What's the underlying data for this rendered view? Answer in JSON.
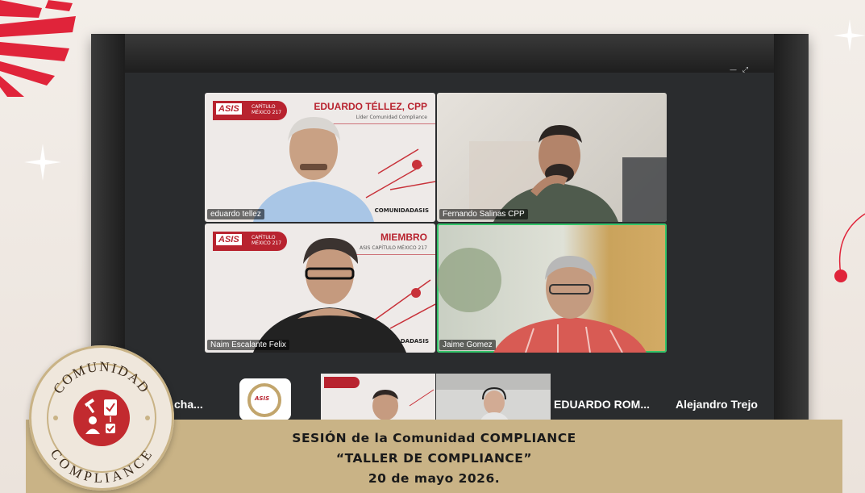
{
  "meeting": {
    "window_controls": "— ⤢",
    "tiles": [
      {
        "name": "eduardo tellez",
        "banner_title": "EDUARDO TÉLLEZ, CPP",
        "banner_sub": "Líder Comunidad Compliance",
        "footer": "COMUNIDADASIS"
      },
      {
        "name": "Fernando Salinas CPP"
      },
      {
        "name": "Naim Escalante Felix",
        "banner_title": "MIEMBRO",
        "banner_sub": "ASIS CAPÍTULO MÉXICO 217",
        "footer": "DADASIS"
      },
      {
        "name": "Jaime Gomez",
        "active_speaker": true
      }
    ],
    "asis_logo": {
      "word": "ASIS",
      "caption": "CAPÍTULO MÉXICO 217"
    },
    "strip": {
      "left_label": "cha...",
      "logo_word": "ASIS",
      "label_3": "EDUARDO  ROM...",
      "label_4": "Alejandro Trejo"
    }
  },
  "caption": {
    "line1": "SESIÓN de la Comunidad COMPLIANCE",
    "line2": "“TALLER DE COMPLIANCE”",
    "line3": "20 de mayo 2026."
  },
  "seal": {
    "top_text": "COMUNIDAD",
    "bottom_text": "COMPLIANCE"
  },
  "colors": {
    "brand_red": "#b8232f",
    "gold": "#c9b386",
    "active_border": "#34c46a"
  }
}
